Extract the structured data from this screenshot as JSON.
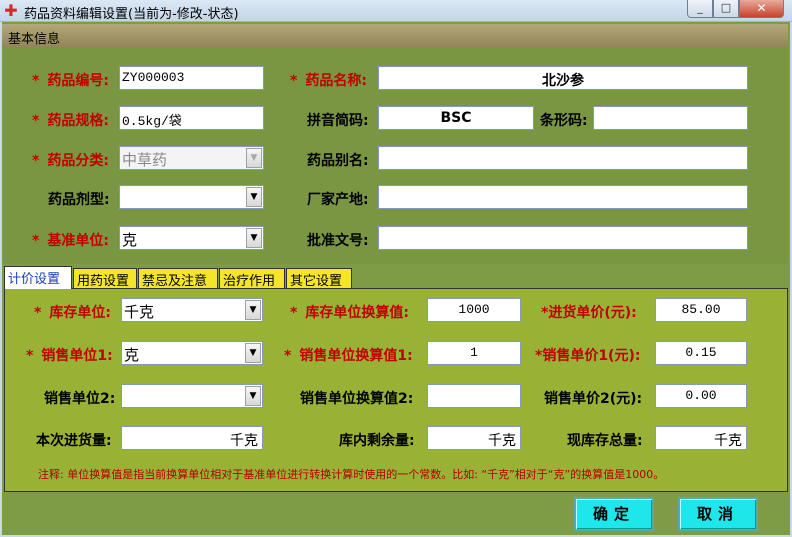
{
  "window": {
    "title": "药品资料编辑设置(当前为-修改-状态)",
    "minimize": "_",
    "maximize": "□",
    "close": "✕"
  },
  "basic": {
    "header": "基本信息",
    "drug_code_label": "药品编号:",
    "drug_code": "ZY000003",
    "drug_name_label": "药品名称:",
    "drug_name": "北沙参",
    "spec_label": "药品规格:",
    "spec": "0.5kg/袋",
    "pinyin_label": "拼音简码:",
    "pinyin": "BSC",
    "barcode_label": "条形码:",
    "barcode": "",
    "category_label": "药品分类:",
    "category": "中草药",
    "alias_label": "药品别名:",
    "alias": "",
    "dosage_label": "药品剂型:",
    "dosage": "",
    "origin_label": "厂家产地:",
    "origin": "",
    "base_unit_label": "基准单位:",
    "base_unit": "克",
    "approval_label": "批准文号:",
    "approval": ""
  },
  "tabs": [
    "计价设置",
    "用药设置",
    "禁忌及注意",
    "治疗作用",
    "其它设置"
  ],
  "pricing": {
    "stock_unit_label": "库存单位:",
    "stock_unit": "千克",
    "stock_conv_label": "库存单位换算值:",
    "stock_conv": "1000",
    "purchase_price_label": "*进货单价(元):",
    "purchase_price": "85.00",
    "sale_unit1_label": "销售单位1:",
    "sale_unit1": "克",
    "sale_conv1_label": "销售单位换算值1:",
    "sale_conv1": "1",
    "sale_price1_label": "*销售单价1(元):",
    "sale_price1": "0.15",
    "sale_unit2_label": "销售单位2:",
    "sale_unit2": "",
    "sale_conv2_label": "销售单位换算值2:",
    "sale_conv2": "",
    "sale_price2_label": "销售单价2(元):",
    "sale_price2": "0.00",
    "this_qty_label": "本次进货量:",
    "this_qty_unit": "千克",
    "remain_label": "库内剩余量:",
    "remain_unit": "千克",
    "total_label": "现库存总量:",
    "total_unit": "千克",
    "note": "注释: 单位换算值是指当前换算单位相对于基准单位进行转换计算时使用的一个常数。比如: “千克”相对于“克”的换算值是1000。"
  },
  "buttons": {
    "ok": "确定",
    "cancel": "取消"
  },
  "required_mark": "*",
  "dropdown_arrow": "▼"
}
